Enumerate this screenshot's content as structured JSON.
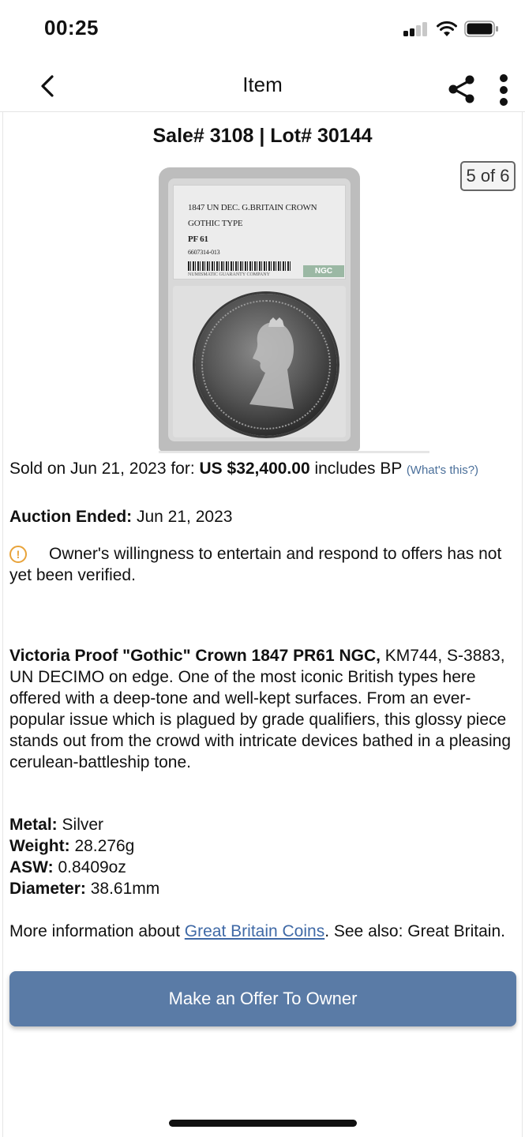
{
  "status_bar": {
    "time": "00:25"
  },
  "nav": {
    "title": "Item",
    "back_icon": "chevron-left-icon",
    "share_icon": "share-icon",
    "more_icon": "more-vertical-icon"
  },
  "lot": {
    "header": "Sale# 3108 | Lot# 30144",
    "image_counter": "5 of 6"
  },
  "slab_label": {
    "line1": "1847 UN DEC. G.BRITAIN CROWN",
    "line2": "GOTHIC TYPE",
    "grade": "PF 61",
    "cert": "6607314-013",
    "company": "NUMISMATIC GUARANTY COMPANY",
    "logo": "NGC"
  },
  "sale": {
    "sold_prefix": "Sold on Jun 21, 2023 for: ",
    "price": "US $32,400.00",
    "sold_suffix": " includes BP ",
    "whats_this": "(What's this?)"
  },
  "auction": {
    "ended_label": "Auction Ended:",
    "ended_value": " Jun 21, 2023"
  },
  "offer_note": {
    "text": "Owner's willingness to entertain and respond to offers has not yet been verified.",
    "icon": "warning-circle-icon",
    "icon_color": "#e8a33a"
  },
  "description": {
    "title": "Victoria Proof \"Gothic\" Crown 1847 PR61 NGC,",
    "body": " KM744, S-3883, UN DECIMO on edge. One of the most iconic British types here offered with a deep-tone and well-kept surfaces. From an ever-popular issue which is plagued by grade qualifiers, this glossy piece stands out from the crowd with intricate devices bathed in a pleasing cerulean-battleship tone."
  },
  "specs": {
    "metal_label": "Metal:",
    "metal_value": " Silver",
    "weight_label": "Weight:",
    "weight_value": " 28.276g",
    "asw_label": "ASW:",
    "asw_value": " 0.8409oz",
    "diameter_label": "Diameter:",
    "diameter_value": " 38.61mm"
  },
  "more_info": {
    "prefix": "More information about ",
    "link": "Great Britain Coins",
    "suffix": ". See also: Great Britain."
  },
  "cta": {
    "label": "Make an Offer To Owner",
    "color": "#5a7ba6"
  }
}
